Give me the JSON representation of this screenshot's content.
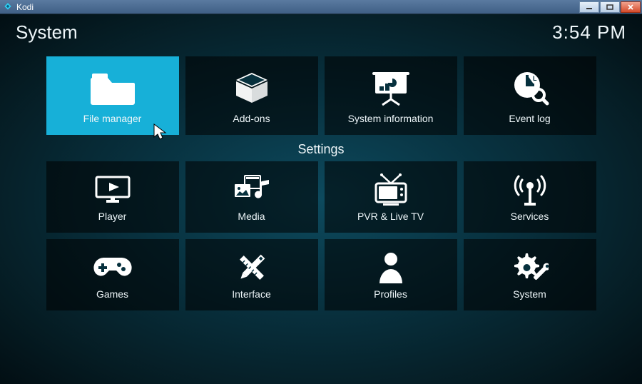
{
  "window": {
    "title": "Kodi"
  },
  "header": {
    "title": "System",
    "clock": "3:54 PM"
  },
  "section1": {
    "tiles": [
      {
        "label": "File manager",
        "icon": "folder-icon",
        "selected": true
      },
      {
        "label": "Add-ons",
        "icon": "box-open-icon",
        "selected": false
      },
      {
        "label": "System information",
        "icon": "presentation-icon",
        "selected": false
      },
      {
        "label": "Event log",
        "icon": "clock-search-icon",
        "selected": false
      }
    ]
  },
  "section2": {
    "heading": "Settings",
    "tiles": [
      {
        "label": "Player",
        "icon": "monitor-play-icon"
      },
      {
        "label": "Media",
        "icon": "media-collection-icon"
      },
      {
        "label": "PVR & Live TV",
        "icon": "tv-antenna-icon"
      },
      {
        "label": "Services",
        "icon": "broadcast-icon"
      },
      {
        "label": "Games",
        "icon": "gamepad-icon"
      },
      {
        "label": "Interface",
        "icon": "pencil-ruler-icon"
      },
      {
        "label": "Profiles",
        "icon": "person-icon"
      },
      {
        "label": "System",
        "icon": "gear-wrench-icon"
      }
    ]
  }
}
